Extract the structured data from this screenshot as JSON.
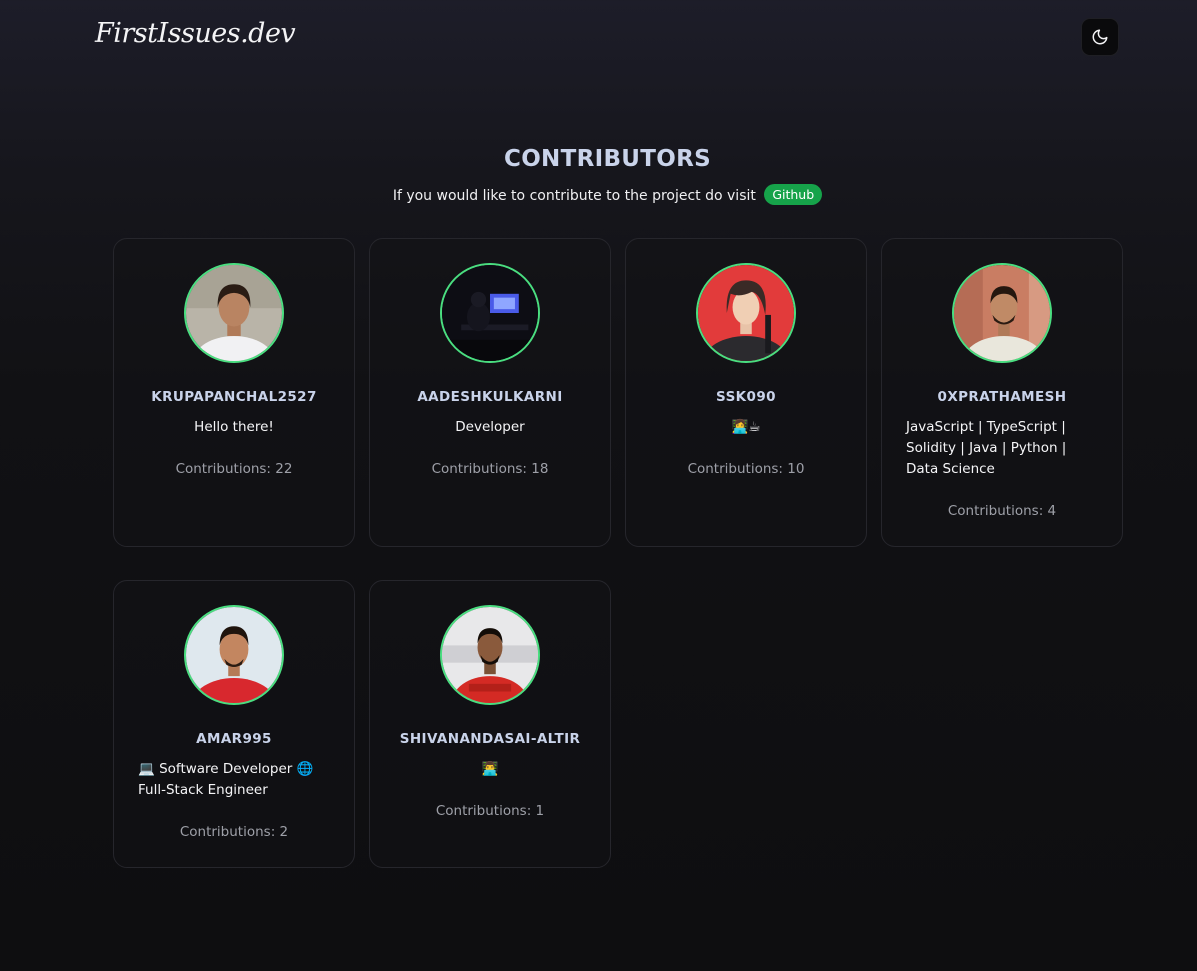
{
  "header": {
    "logo": "FirstIssues.dev",
    "theme_toggle_icon": "moon-icon"
  },
  "intro": {
    "title": "CONTRIBUTORS",
    "subtitle": "If you would like to contribute to the project do visit",
    "github_label": "Github"
  },
  "accent_color": "#4ade80",
  "badge_color": "#16a34a",
  "contributors": [
    {
      "username": "KRUPAPANCHAL2527",
      "bio": "Hello there!",
      "contributions": "Contributions: 22"
    },
    {
      "username": "AADESHKULKARNI",
      "bio": "Developer",
      "contributions": "Contributions: 18"
    },
    {
      "username": "SSK090",
      "bio": "👩‍💻☕",
      "contributions": "Contributions: 10"
    },
    {
      "username": "0XPRATHAMESH",
      "bio": "JavaScript | TypeScript | Solidity | Java | Python | Data Science",
      "contributions": "Contributions: 4"
    },
    {
      "username": "AMAR995",
      "bio": "💻 Software Developer 🌐 Full-Stack Engineer",
      "contributions": "Contributions: 2"
    },
    {
      "username": "SHIVANANDASAI-ALTIR",
      "bio": "👨‍💻",
      "contributions": "Contributions: 1"
    }
  ]
}
